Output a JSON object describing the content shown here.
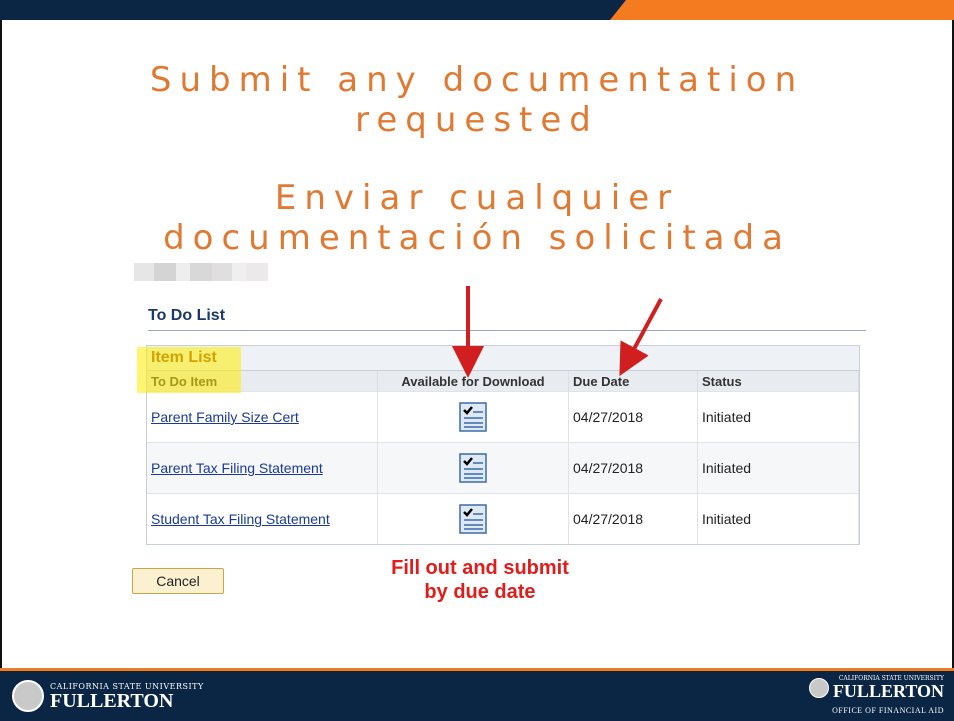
{
  "slide": {
    "title_en": "Submit any documentation requested",
    "title_es": "Enviar cualquier documentación solicitada",
    "title_color": "#e07a33",
    "accent_color": "#f47b20",
    "navy_color": "#0b2545"
  },
  "todo": {
    "heading": "To Do List",
    "grid_title": "Item List",
    "columns": {
      "item": "To Do Item",
      "download": "Available for Download",
      "due": "Due Date",
      "status": "Status"
    },
    "rows": [
      {
        "item": "Parent Family Size Cert",
        "download_icon": "document-checklist-icon",
        "due": "04/27/2018",
        "status": "Initiated"
      },
      {
        "item": "Parent Tax Filing Statement",
        "download_icon": "document-checklist-icon",
        "due": "04/27/2018",
        "status": "Initiated"
      },
      {
        "item": "Student Tax Filing Statement",
        "download_icon": "document-checklist-icon",
        "due": "04/27/2018",
        "status": "Initiated"
      }
    ],
    "cancel_label": "Cancel"
  },
  "annotation": {
    "text_line1": "Fill out and submit",
    "text_line2": "by due date",
    "color": "#e21b1b"
  },
  "footer": {
    "left_small": "CALIFORNIA STATE UNIVERSITY",
    "left_big": "FULLERTON",
    "right_small": "CALIFORNIA STATE UNIVERSITY",
    "right_big": "FULLERTON",
    "right_sub": "OFFICE OF FINANCIAL AID"
  }
}
